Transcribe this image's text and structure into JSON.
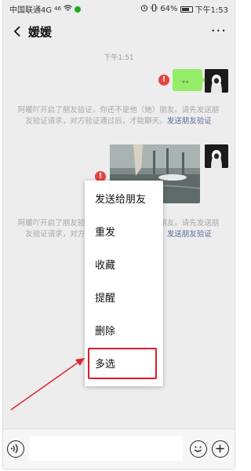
{
  "status_bar": {
    "carrier": "中国联通4G",
    "signal_super": "46",
    "battery_pct": "64%",
    "time": "下午1:53"
  },
  "header": {
    "contact_name": "媛媛",
    "more_label": "···"
  },
  "chat": {
    "timestamp": "下午1:51",
    "first_message_text": "。。",
    "error_mark": "!",
    "notice_text": "阿暖吖开启了朋友验证，你还不是他（她）朋友。请先发送朋友验证请求，对方验证通过后，才能聊天。",
    "notice_link": "发送朋友验证"
  },
  "context_menu": {
    "items": [
      "发送给朋友",
      "重发",
      "收藏",
      "提醒",
      "删除",
      "多选"
    ],
    "highlighted_item": "多选"
  },
  "input_bar": {
    "placeholder": ""
  },
  "colors": {
    "bubble_green": "#95ec69",
    "error_red": "#e64340",
    "highlight_red": "#d91c29",
    "link_blue": "#576b95",
    "background": "#ededed"
  },
  "icons": [
    "back-icon",
    "more-icon",
    "error-icon",
    "voice-icon",
    "emoji-icon",
    "plus-icon",
    "annotation-arrow"
  ]
}
